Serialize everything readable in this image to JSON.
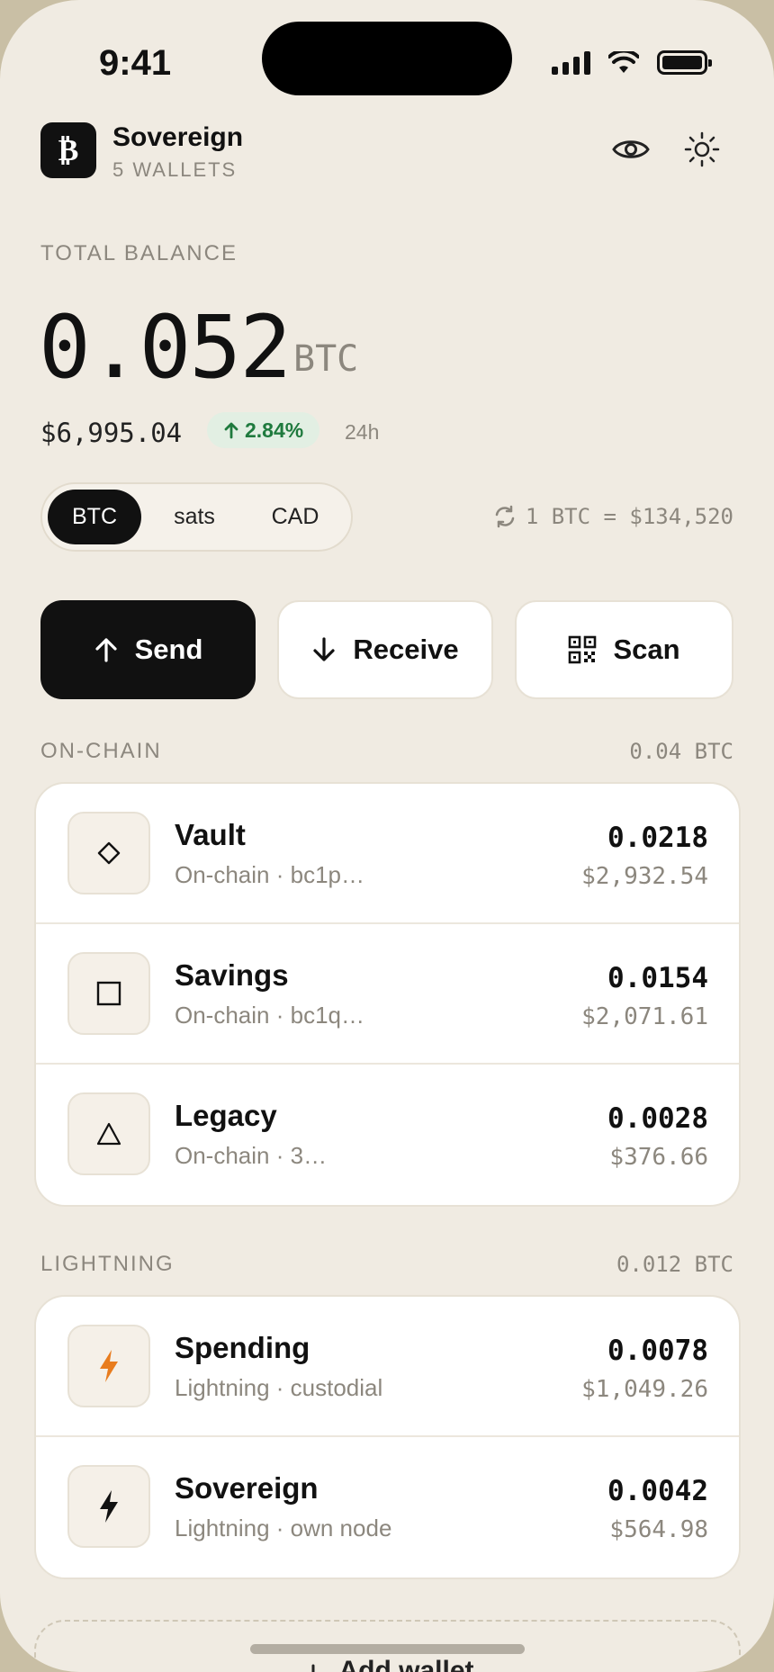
{
  "status_bar": {
    "time": "9:41"
  },
  "header": {
    "logo_glyph": "₿",
    "title": "Sovereign",
    "subtitle": "5 WALLETS"
  },
  "balance": {
    "label": "TOTAL BALANCE",
    "value": "0.052",
    "unit": "BTC",
    "fiat": "$6,995.04",
    "change": "2.84%",
    "change_period": "24h"
  },
  "units": {
    "options": [
      "BTC",
      "sats",
      "CAD"
    ],
    "selected": "BTC"
  },
  "rate": "1 BTC = $134,520",
  "actions": {
    "send": "Send",
    "receive": "Receive",
    "scan": "Scan"
  },
  "onchain": {
    "label": "ON-CHAIN",
    "total": "0.04 BTC",
    "wallets": [
      {
        "name": "Vault",
        "meta": "On-chain · bc1p…",
        "btc": "0.0218",
        "fiat": "$2,932.54",
        "icon": "diamond-icon"
      },
      {
        "name": "Savings",
        "meta": "On-chain · bc1q…",
        "btc": "0.0154",
        "fiat": "$2,071.61",
        "icon": "square-icon"
      },
      {
        "name": "Legacy",
        "meta": "On-chain · 3…",
        "btc": "0.0028",
        "fiat": "$376.66",
        "icon": "triangle-icon"
      }
    ]
  },
  "lightning": {
    "label": "LIGHTNING",
    "total": "0.012 BTC",
    "wallets": [
      {
        "name": "Spending",
        "meta": "Lightning · custodial",
        "btc": "0.0078",
        "fiat": "$1,049.26",
        "icon": "bolt-orange-icon"
      },
      {
        "name": "Sovereign",
        "meta": "Lightning · own node",
        "btc": "0.0042",
        "fiat": "$564.98",
        "icon": "bolt-icon"
      }
    ]
  },
  "add_wallet": "Add wallet",
  "colors": {
    "accent_orange": "#e87c1e",
    "positive_green": "#1f7a3e",
    "background": "#f0ebe2"
  }
}
